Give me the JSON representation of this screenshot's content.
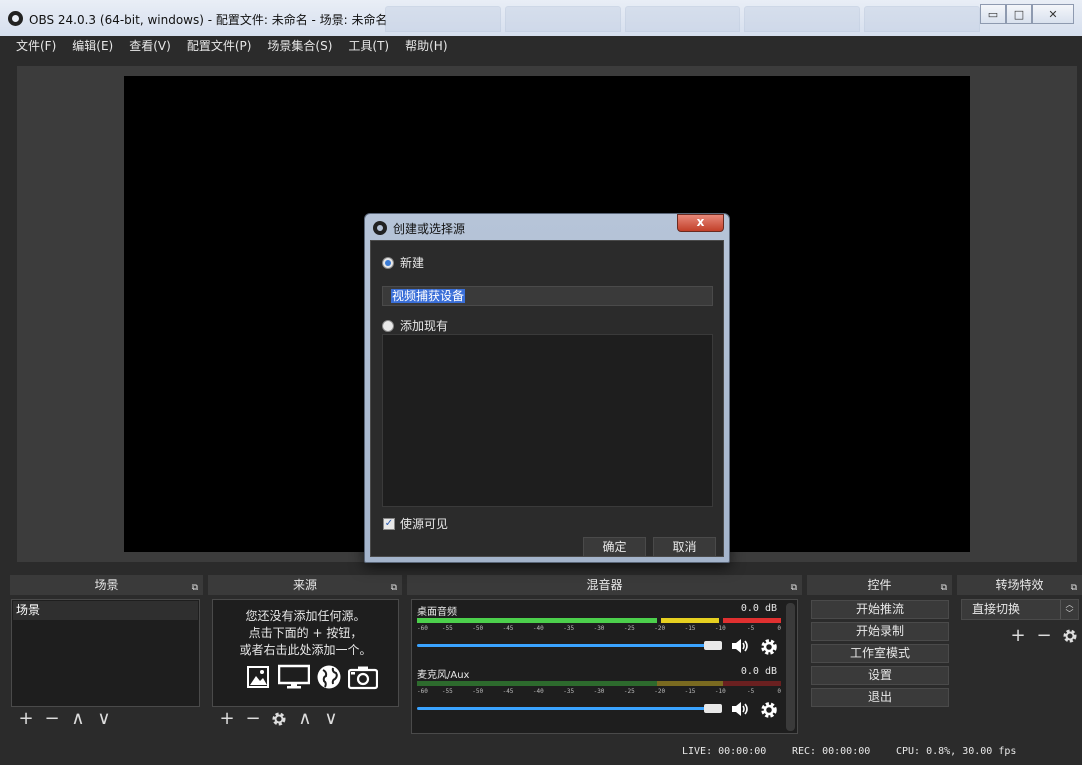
{
  "window": {
    "title": "OBS 24.0.3 (64-bit, windows) - 配置文件: 未命名 - 场景: 未命名",
    "minimize_glyph": "▭",
    "maximize_glyph": "□",
    "close_glyph": "✕"
  },
  "menu": [
    "文件(F)",
    "编辑(E)",
    "查看(V)",
    "配置文件(P)",
    "场景集合(S)",
    "工具(T)",
    "帮助(H)"
  ],
  "docks": {
    "scenes": {
      "title": "场景",
      "items": [
        "场景"
      ]
    },
    "sources": {
      "title": "来源",
      "empty_text": [
        "您还没有添加任何源。",
        "点击下面的 + 按钮，",
        "或者右击此处添加一个。"
      ]
    },
    "mixer": {
      "title": "混音器",
      "tracks": [
        {
          "name": "桌面音频",
          "db": "0.0 dB",
          "active": true
        },
        {
          "name": "麦克风/Aux",
          "db": "0.0 dB",
          "active": false
        }
      ],
      "ticks": [
        "-60",
        "-55",
        "-50",
        "-45",
        "-40",
        "-35",
        "-30",
        "-25",
        "-20",
        "-15",
        "-10",
        "-5",
        "0"
      ]
    },
    "controls": {
      "title": "控件",
      "buttons": [
        "开始推流",
        "开始录制",
        "工作室模式",
        "设置",
        "退出"
      ]
    },
    "transitions": {
      "title": "转场特效",
      "selected": "直接切换"
    }
  },
  "toolbar_glyphs": {
    "add": "+",
    "remove": "−",
    "up": "∧",
    "down": "∨",
    "float": "⧉"
  },
  "status": {
    "live": "LIVE: 00:00:00",
    "rec": "REC: 00:00:00",
    "cpu": "CPU: 0.8%, 30.00 fps"
  },
  "dialog": {
    "title": "创建或选择源",
    "close_glyph": "x",
    "new_label": "新建",
    "new_name_value": "视频捕获设备",
    "existing_label": "添加现有",
    "visible_label": "使源可见",
    "visible_checked": true,
    "ok_label": "确定",
    "cancel_label": "取消"
  },
  "colors": {
    "meter_green": "#4cd04c",
    "meter_yellow": "#e6d020",
    "meter_red": "#e03030",
    "slider_blue": "#3aa3ff",
    "selection_blue": "#3a6fd8"
  }
}
